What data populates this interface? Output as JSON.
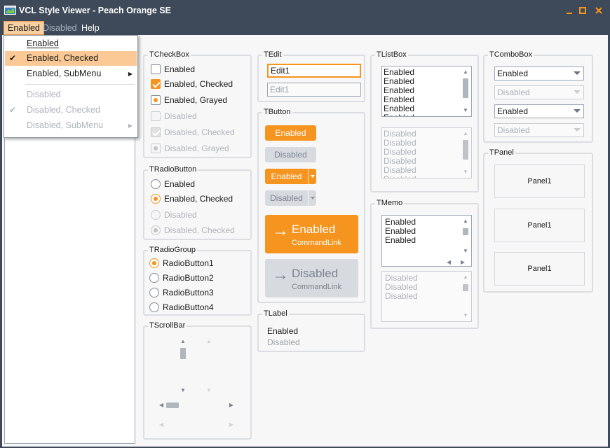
{
  "window": {
    "title": "VCL Style Viewer - Peach Orange SE"
  },
  "menubar": {
    "items": [
      {
        "label": "Enabled"
      },
      {
        "label": "Disabled"
      },
      {
        "label": "Help"
      }
    ]
  },
  "dropdown": {
    "items": [
      {
        "label": "Enabled",
        "underline": "E"
      },
      {
        "label": "Enabled, Checked",
        "checked": true
      },
      {
        "label": "Enabled, SubMenu",
        "submenu": true
      },
      {
        "label": "Disabled"
      },
      {
        "label": "Disabled, Checked",
        "checked": true
      },
      {
        "label": "Disabled, SubMenu",
        "submenu": true
      }
    ]
  },
  "checkbox_group": {
    "title": "TCheckBox",
    "items": [
      {
        "label": "Enabled",
        "state": "unchecked"
      },
      {
        "label": "Enabled, Checked",
        "state": "checked"
      },
      {
        "label": "Enabled, Grayed",
        "state": "grayed"
      },
      {
        "label": "Disabled",
        "state": "unchecked"
      },
      {
        "label": "Disabled, Checked",
        "state": "checked"
      },
      {
        "label": "Disabled, Grayed",
        "state": "grayed"
      }
    ]
  },
  "radiobutton_group": {
    "title": "TRadioButton",
    "items": [
      {
        "label": "Enabled"
      },
      {
        "label": "Enabled, Checked"
      },
      {
        "label": "Disabled"
      },
      {
        "label": "Disabled, Checked"
      }
    ]
  },
  "radiogroup": {
    "title": "TRadioGroup",
    "items": [
      {
        "label": "RadioButton1"
      },
      {
        "label": "RadioButton2"
      },
      {
        "label": "RadioButton3"
      },
      {
        "label": "RadioButton4"
      }
    ],
    "selected_index": 0
  },
  "scrollbar_group": {
    "title": "TScrollBar"
  },
  "edit_group": {
    "title": "TEdit",
    "enabled_value": "Edit1",
    "disabled_value": "Edit1"
  },
  "button_group": {
    "title": "TButton",
    "enabled_label": "Enabled",
    "disabled_label": "Disabled",
    "split_enabled_label": "Enabled",
    "split_disabled_label": "Disabled",
    "cmd_enabled_title": "Enabled",
    "cmd_enabled_subtitle": "CommandLink",
    "cmd_disabled_title": "Disabled",
    "cmd_disabled_subtitle": "CommandLink"
  },
  "label_group": {
    "title": "TLabel",
    "enabled": "Enabled",
    "disabled": "Disabled"
  },
  "listbox_group": {
    "title": "TListBox",
    "enabled_items": [
      "Enabled",
      "Enabled",
      "Enabled",
      "Enabled",
      "Enabled",
      "Enabled"
    ],
    "disabled_items": [
      "Disabled",
      "Disabled",
      "Disabled",
      "Disabled",
      "Disabled",
      "Disabled"
    ]
  },
  "memo_group": {
    "title": "TMemo",
    "enabled_lines": [
      "Enabled",
      "Enabled",
      "Enabled"
    ],
    "disabled_lines": [
      "Disabled",
      "Disabled",
      "Disabled"
    ]
  },
  "combobox_group": {
    "title": "TComboBox",
    "items": [
      {
        "value": "Enabled",
        "enabled": true
      },
      {
        "value": "Disabled",
        "enabled": false
      },
      {
        "value": "Enabled",
        "enabled": true
      },
      {
        "value": "Disabled",
        "enabled": false
      }
    ]
  },
  "panel_group": {
    "title": "TPanel",
    "panels": [
      "Panel1",
      "Panel1",
      "Panel1"
    ]
  },
  "colors": {
    "accent": "#f5941e",
    "titlebar": "#3e4a59",
    "highlight": "#fbc995"
  }
}
